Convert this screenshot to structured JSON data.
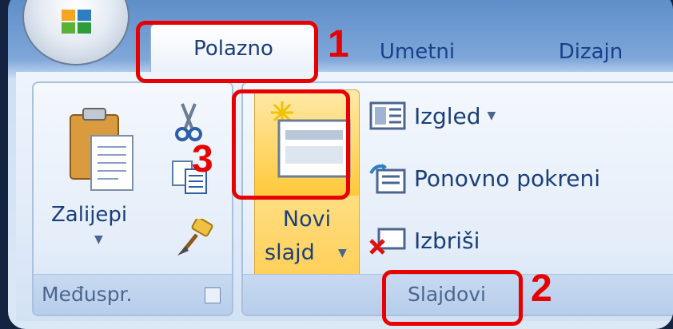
{
  "tabs": [
    {
      "label": "Polazno"
    },
    {
      "label": "Umetni"
    },
    {
      "label": "Dizajn"
    }
  ],
  "clipboard": {
    "paste_label": "Zalijepi",
    "group_label": "Međuspr."
  },
  "slides": {
    "new_slide_line1": "Novi",
    "new_slide_line2": "slajd",
    "layout_label": "Izgled",
    "reset_label": "Ponovno pokreni",
    "delete_label": "Izbriši",
    "group_label": "Slajdovi"
  },
  "annotations": [
    "1",
    "2",
    "3"
  ],
  "colors": {
    "annotation": "#e60000",
    "text": "#1b3f7a"
  }
}
